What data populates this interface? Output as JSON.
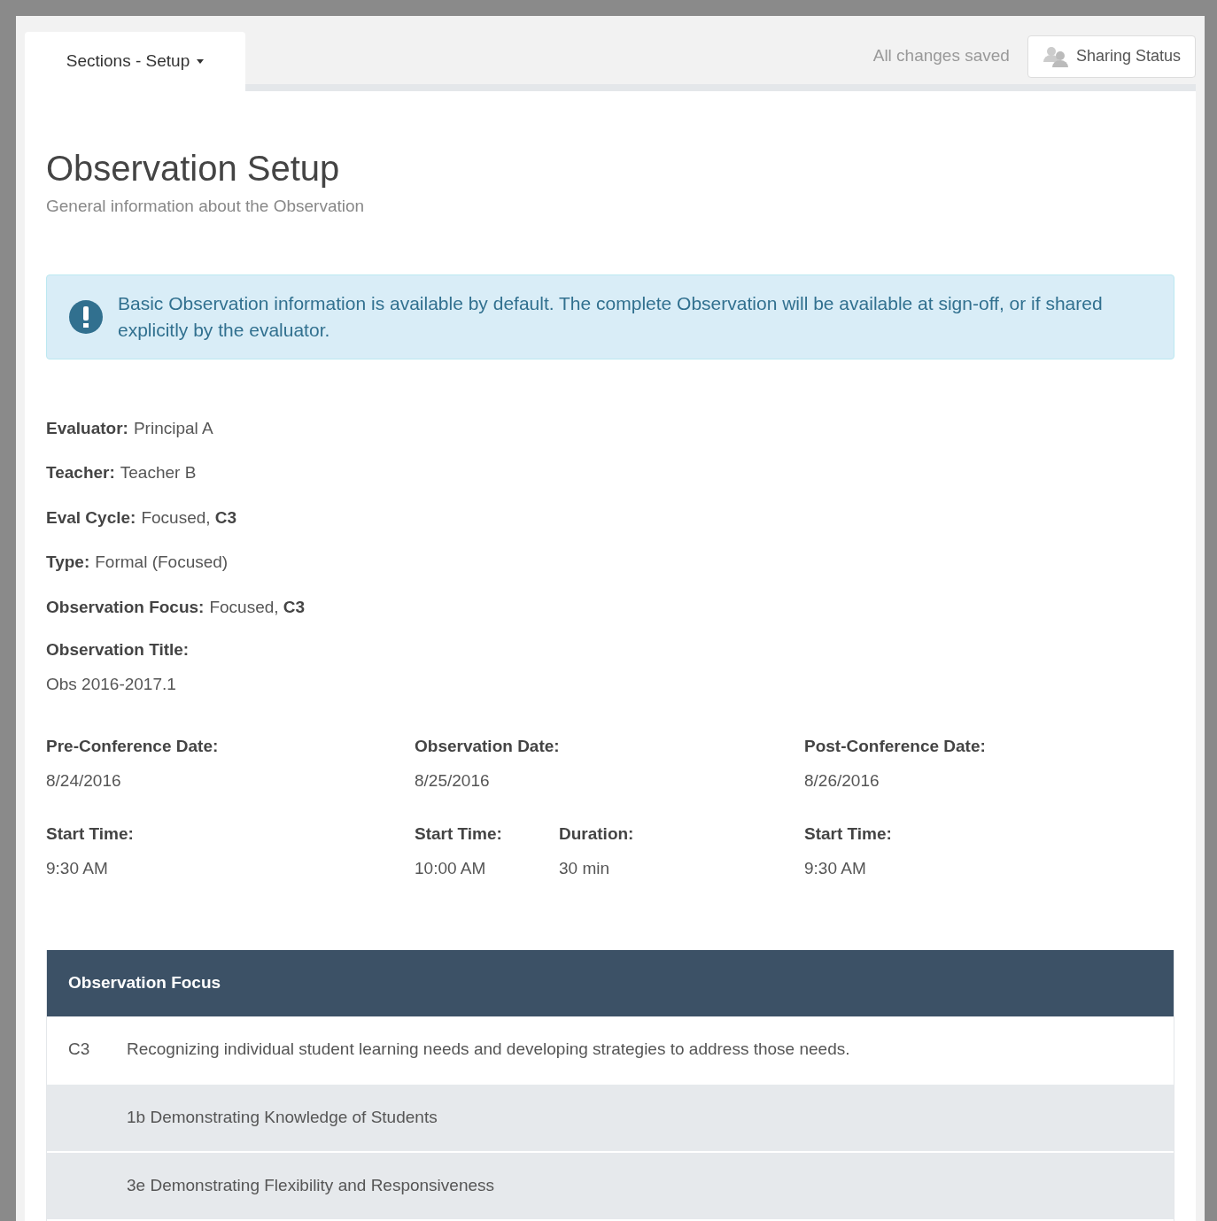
{
  "top_bar": {
    "sections_tab": {
      "label": "Sections - Setup",
      "selected": true
    },
    "save_status": "All changes saved",
    "sharing_button": "Sharing Status"
  },
  "header": {
    "title": "Observation Setup",
    "subtitle": "General information about the Observation"
  },
  "alert": {
    "text": "Basic Observation information is available by default. The complete Observation will be available at sign-off, or if shared explicitly by the evaluator."
  },
  "details": [
    {
      "label": "Evaluator:",
      "value": "Principal A"
    },
    {
      "label": "Teacher:",
      "value": "Teacher B"
    },
    {
      "label": "Eval Cycle:",
      "value": "Focused, **C3**"
    },
    {
      "label": "Type:",
      "value": "Formal (Focused)"
    },
    {
      "label": "Observation Focus:",
      "value": "Focused, **C3**"
    }
  ],
  "observation_title": {
    "label": "Observation Title:",
    "value": "Obs 2016-2017.1"
  },
  "schedule": [
    {
      "label": "Pre-Conference Date:",
      "value": "8/24/2016"
    },
    {
      "label": "Observation Date:",
      "value": "8/25/2016"
    },
    {
      "label": "Post-Conference Date:",
      "value": "8/26/2016"
    },
    {
      "label": "Start Time:",
      "value": "9:30 AM"
    },
    {
      "label": "Start Time:",
      "value": "10:00 AM"
    },
    {
      "label": "Duration:",
      "value": "30 min"
    },
    {
      "label": "Start Time:",
      "value": "9:30 AM"
    }
  ],
  "focus_table": {
    "heading": "Observation Focus",
    "rows": [
      {
        "kind": "standard",
        "code": "C3",
        "text": "Recognizing individual student learning needs and developing strategies to address those needs."
      },
      {
        "kind": "component",
        "text": "1b Demonstrating Knowledge of Students"
      },
      {
        "kind": "component",
        "text": "3e Demonstrating Flexibility and Responsiveness"
      }
    ]
  }
}
